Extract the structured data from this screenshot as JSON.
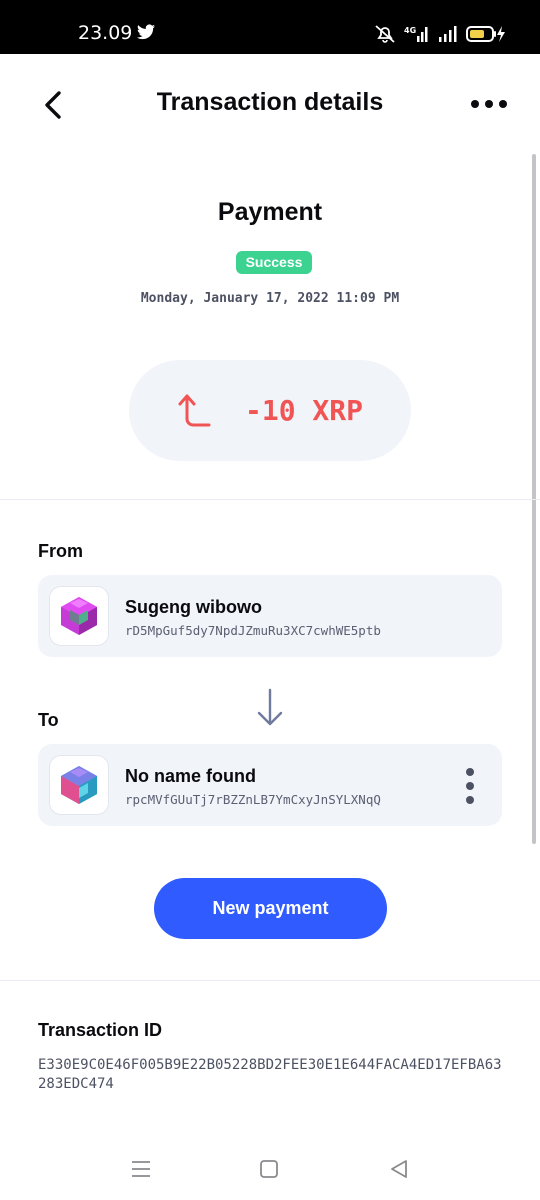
{
  "status_bar": {
    "time": "23.09",
    "network": "4G"
  },
  "header": {
    "title": "Transaction details"
  },
  "transaction": {
    "type": "Payment",
    "status": "Success",
    "date": "Monday, January 17, 2022 11:09 PM",
    "amount": "-10 XRP",
    "id": "E330E9C0E46F005B9E22B05228BD2FEE30E1E644FACA4ED17EFBA63283EDC474"
  },
  "from": {
    "label": "From",
    "name": "Sugeng wibowo",
    "address": "rD5MpGuf5dy7NpdJZmuRu3XC7cwhWE5ptb"
  },
  "to": {
    "label": "To",
    "name": "No name found",
    "address": "rpcMVfGUuTj7rBZZnLB7YmCxyJnSYLXNqQ"
  },
  "actions": {
    "new_payment": "New payment"
  },
  "txid_section": {
    "label": "Transaction ID"
  },
  "colors": {
    "accent": "#2f5bff",
    "success": "#3cd391",
    "debit": "#f05454",
    "card_bg": "#f1f4f9"
  }
}
